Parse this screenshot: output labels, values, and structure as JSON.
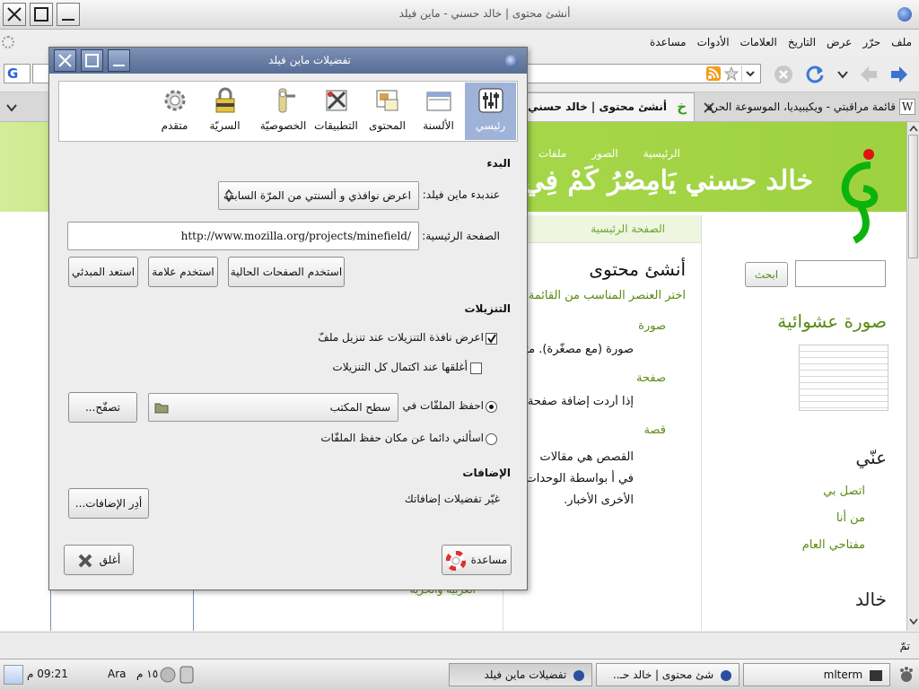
{
  "window": {
    "title": "أنشئ محتوى | خالد حسني - ماين فيلد"
  },
  "menubar": [
    "ملف",
    "حرّر",
    "عرض",
    "التاريخ",
    "العلامات",
    "الأدوات",
    "مساعدة"
  ],
  "tabs": [
    {
      "label": "قائمة مراقبتي - ويكيبيديا، الموسوعة الحرة"
    },
    {
      "label": "أنشئ محتوى | خالد حسني"
    }
  ],
  "site": {
    "nav": [
      "الرئيسية",
      "الصور",
      "ملفات"
    ],
    "logo_text": "خالد حسني يَامِصْرُ كَمْ فِي",
    "search_button": "ابحث",
    "breadcrumb": "الصفحة الرئيسية",
    "content_title": "أنشئ محتوى",
    "content_intro": "اختر العنصر المناسب من القائمة:",
    "items": [
      {
        "title": "صورة",
        "desc": "صورة (مع مصغّرة). مثالي"
      },
      {
        "title": "صفحة",
        "desc": "إذا أردت إضافة صفحة ثا"
      },
      {
        "title": "قصة",
        "desc": "القصص هي مقالات في أ بواسطة الوحدات الأخرى الأخبار."
      }
    ],
    "random_image_title": "صورة عشوائية",
    "about_title": "عنّي",
    "about_links": [
      "اتصل بي",
      "من أنا",
      "مفتاحي العام"
    ],
    "side_title": "خالد",
    "footer_text": "العربية والحرية"
  },
  "status": {
    "text": "تمّ"
  },
  "taskbar": {
    "tasks": [
      "تفضيلات ماين فيلد",
      "شئ محتوى | خالد حـ..",
      "mlterm"
    ],
    "clock": "09:21 م",
    "layout": "Ara",
    "date": "١٥ م"
  },
  "dialog": {
    "title": "تفضيلات ماين فيلد",
    "panes": [
      {
        "label": "رئيسي",
        "icon": "sliders-icon",
        "selected": true
      },
      {
        "label": "الألسنة",
        "icon": "tabs-icon"
      },
      {
        "label": "المحتوى",
        "icon": "content-icon"
      },
      {
        "label": "التطبيقات",
        "icon": "applications-icon"
      },
      {
        "label": "الخصوصيّة",
        "icon": "privacy-icon"
      },
      {
        "label": "السريّة",
        "icon": "lock-icon"
      },
      {
        "label": "متقدم",
        "icon": "gear-icon"
      }
    ],
    "startup": {
      "section": "البدء",
      "when_label": "عندبدء ماين فيلد:",
      "when_value": "اعرض نوافذي و ألسنتي من المرّة السابقة",
      "home_label": "الصفحة الرئيسية:",
      "home_value": "http://www.mozilla.org/projects/minefield/",
      "btn_current": "استخدم الصفحات الحالية",
      "btn_bookmark": "استخدم علامة",
      "btn_default": "استعد المبدئي"
    },
    "downloads": {
      "section": "التنزيلات",
      "show_window": "اعرض نافذة التنزيلات عند تنزيل ملفّ",
      "show_window_checked": true,
      "close_when_done": "أغلقها عند اكتمال كل التنزيلات",
      "close_checked": false,
      "save_to_label": "احفظ الملفّات في",
      "save_to_value": "سطح المكتب",
      "browse": "تصفّح...",
      "always_ask": "اسألني دائما عن مكان حفظ الملفّات"
    },
    "addons": {
      "section": "الإضافات",
      "desc": "غيّر تفضيلات إضافاتك",
      "manage": "أدِر الإضافات..."
    },
    "help_button": "مساعدة",
    "close_button": "أغلق"
  },
  "colors": {
    "accent": "#9fb3d9",
    "site_green": "#6fbf17",
    "title_blue": "#5d739c"
  }
}
